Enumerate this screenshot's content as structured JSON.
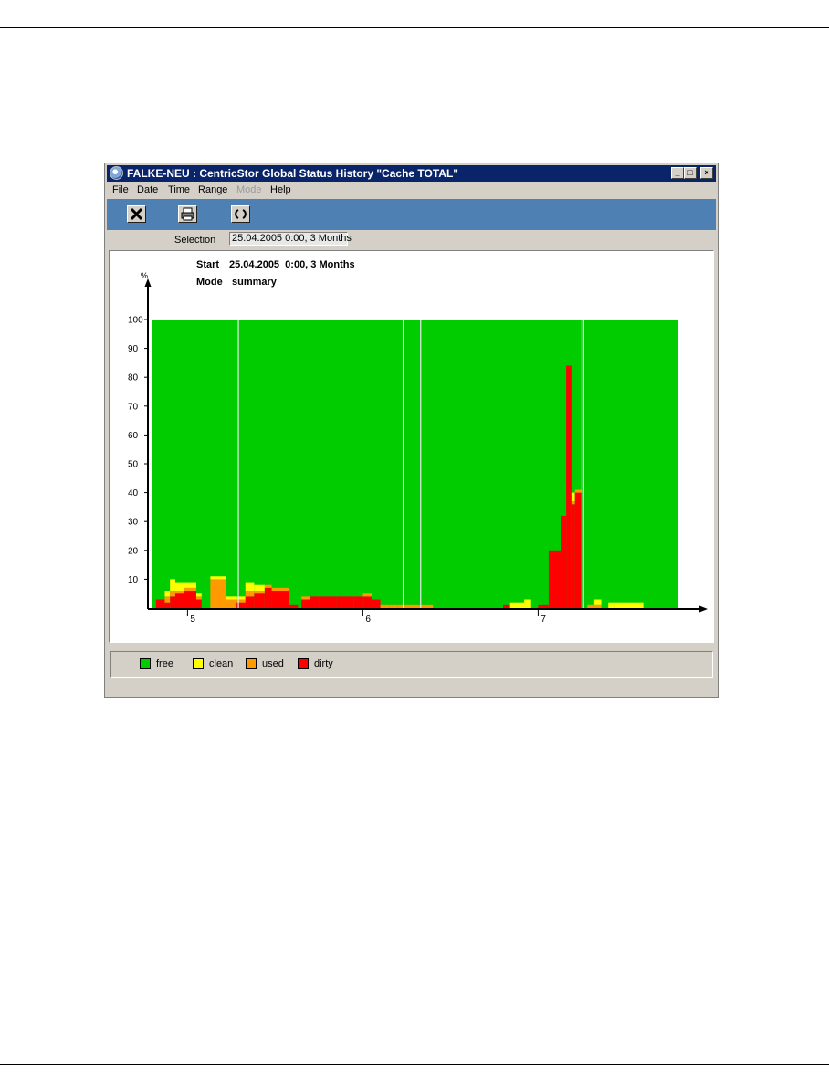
{
  "window": {
    "title": "FALKE-NEU : CentricStor Global Status History \"Cache TOTAL\"",
    "controls": {
      "minimize": "_",
      "maximize": "□",
      "close": "×"
    }
  },
  "menu": {
    "items": [
      {
        "label": "File",
        "enabled": true
      },
      {
        "label": "Date",
        "enabled": true
      },
      {
        "label": "Time",
        "enabled": true
      },
      {
        "label": "Range",
        "enabled": true
      },
      {
        "label": "Mode",
        "enabled": false
      },
      {
        "label": "Help",
        "enabled": true
      }
    ]
  },
  "toolbar": {
    "buttons": [
      {
        "icon": "close-x-icon"
      },
      {
        "icon": "print-icon"
      },
      {
        "icon": "refresh-icon"
      }
    ]
  },
  "selection": {
    "label": "Selection",
    "value": "25.04.2005  0:00, 3 Months"
  },
  "plot": {
    "start_label": "Start",
    "start_value": "25.04.2005  0:00, 3 Months",
    "mode_label": "Mode",
    "mode_value": "summary"
  },
  "legend": [
    {
      "name": "free",
      "color": "#00cc00"
    },
    {
      "name": "clean",
      "color": "#ffff00"
    },
    {
      "name": "used",
      "color": "#ff9900"
    },
    {
      "name": "dirty",
      "color": "#ff0000"
    }
  ],
  "chart_data": {
    "type": "area",
    "ylabel": "%",
    "ylim": [
      0,
      100
    ],
    "yticks": [
      10,
      20,
      30,
      40,
      50,
      60,
      70,
      80,
      90,
      100
    ],
    "xlim": [
      4.8,
      7.8
    ],
    "xticks": [
      5,
      6,
      7
    ],
    "stacking": "dirty, used, clean from bottom; free fills to 100",
    "gaps_x": [
      5.29,
      6.23,
      6.33,
      7.25,
      7.26
    ],
    "colors": {
      "free": "#00cc00",
      "clean": "#ffff00",
      "used": "#ff9900",
      "dirty": "#ff0000"
    },
    "x": [
      4.82,
      4.87,
      4.9,
      4.93,
      4.98,
      5.05,
      5.08,
      5.13,
      5.22,
      5.28,
      5.33,
      5.38,
      5.44,
      5.48,
      5.58,
      5.63,
      5.65,
      5.7,
      5.75,
      5.85,
      5.95,
      6.0,
      6.05,
      6.1,
      6.15,
      6.2,
      6.4,
      6.6,
      6.78,
      6.8,
      6.84,
      6.92,
      6.96,
      7.0,
      7.02,
      7.06,
      7.13,
      7.16,
      7.19,
      7.21,
      7.25,
      7.28,
      7.32,
      7.36,
      7.4,
      7.44,
      7.6,
      7.8
    ],
    "series": [
      {
        "name": "dirty",
        "values": [
          3,
          2,
          4,
          5,
          6,
          3,
          0,
          0,
          0,
          2,
          4,
          5,
          7,
          6,
          1,
          0,
          3,
          4,
          4,
          4,
          4,
          4,
          3,
          0,
          0,
          0,
          0,
          0,
          0,
          1,
          0,
          0,
          0,
          1,
          1,
          20,
          32,
          84,
          36,
          40,
          0,
          0,
          0,
          0,
          0,
          0,
          0,
          0
        ]
      },
      {
        "name": "used",
        "values": [
          0,
          2,
          2,
          1,
          1,
          1,
          0,
          10,
          3,
          1,
          2,
          1,
          1,
          1,
          0,
          0,
          1,
          0,
          0,
          0,
          0,
          1,
          0,
          1,
          1,
          1,
          0,
          0,
          0,
          0,
          0,
          0,
          0,
          0,
          0,
          0,
          0,
          0,
          1,
          1,
          0,
          1,
          1,
          0,
          0,
          0,
          0,
          0
        ]
      },
      {
        "name": "clean",
        "values": [
          0,
          2,
          4,
          3,
          2,
          1,
          0,
          1,
          1,
          1,
          3,
          2,
          0,
          0,
          0,
          0,
          0,
          0,
          0,
          0,
          0,
          0,
          0,
          0,
          0,
          0,
          0,
          0,
          0,
          0,
          2,
          3,
          0,
          0,
          0,
          0,
          0,
          0,
          3,
          0,
          0,
          0,
          2,
          0,
          2,
          2,
          0,
          0
        ]
      }
    ]
  }
}
